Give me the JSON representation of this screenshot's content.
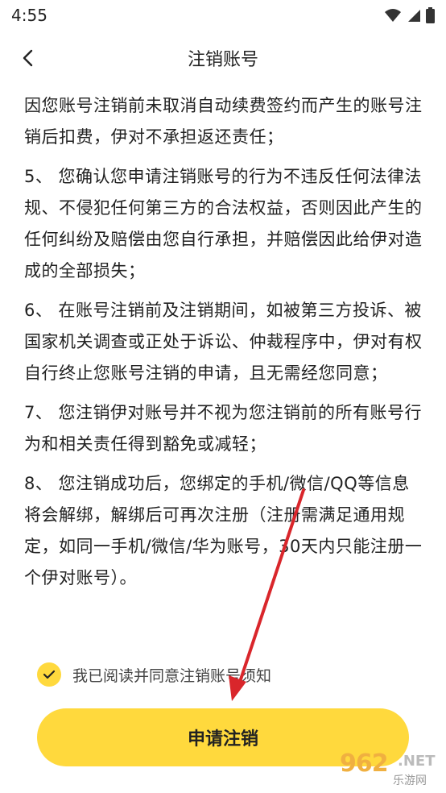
{
  "status_bar": {
    "time": "4:55",
    "icons": [
      "wifi-icon",
      "signal-icon",
      "battery-icon"
    ]
  },
  "header": {
    "title": "注销账号",
    "back_icon": "chevron-left-icon"
  },
  "content": {
    "partial_top": "因您账号注销前未取消自动续费签约而产生的账号注销后扣费，伊对不承担返还责任；",
    "clauses": [
      "5、 您确认您申请注销账号的行为不违反任何法律法规、不侵犯任何第三方的合法权益，否则因此产生的任何纠纷及赔偿由您自行承担，并赔偿因此给伊对造成的全部损失；",
      "6、 在账号注销前及注销期间，如被第三方投诉、被国家机关调查或正处于诉讼、仲裁程序中，伊对有权自行终止您账号注销的申请，且无需经您同意；",
      "7、 您注销伊对账号并不视为您注销前的所有账号行为和相关责任得到豁免或减轻；",
      "8、 您注销成功后，您绑定的手机/微信/QQ等信息将会解绑，解绑后可再次注册（注册需满足通用规定，如同一手机/微信/华为账号，30天内只能注册一个伊对账号）。"
    ]
  },
  "agreement": {
    "checked": true,
    "label": "我已阅读并同意注销账号须知"
  },
  "actions": {
    "apply_label": "申请注销"
  },
  "watermark": {
    "number": "962",
    "suffix": ".NET",
    "sub": "乐游网"
  },
  "colors": {
    "accent": "#FFD93D",
    "arrow": "#d9262b"
  }
}
